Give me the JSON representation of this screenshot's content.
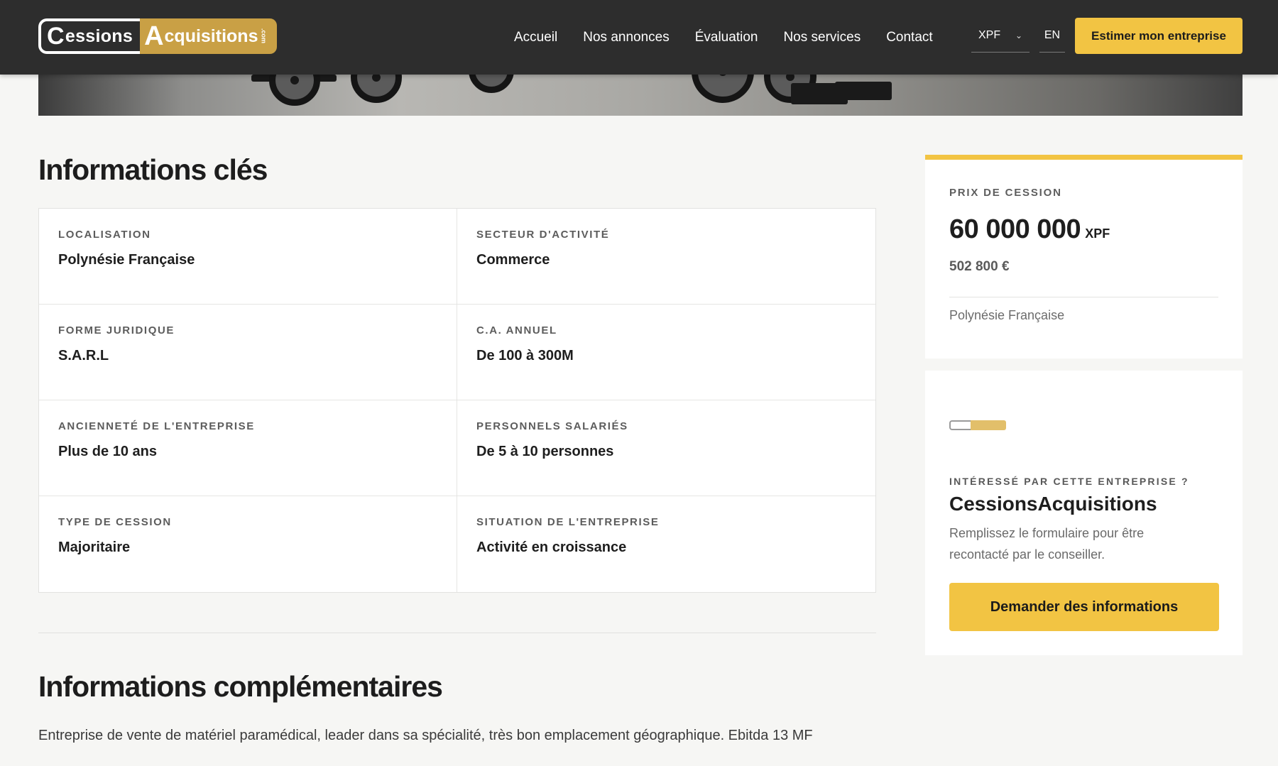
{
  "header": {
    "logo_left_cap": "C",
    "logo_left_text": "essions",
    "logo_right_cap": "A",
    "logo_right_text": "cquisitions",
    "logo_right_suffix": ".com",
    "nav": [
      "Accueil",
      "Nos annonces",
      "Évaluation",
      "Nos services",
      "Contact"
    ],
    "currency": "XPF",
    "language": "EN",
    "cta": "Estimer mon entreprise"
  },
  "key_info": {
    "title": "Informations clés",
    "items": [
      {
        "label": "LOCALISATION",
        "value": "Polynésie Française"
      },
      {
        "label": "SECTEUR D'ACTIVITÉ",
        "value": "Commerce"
      },
      {
        "label": "FORME JURIDIQUE",
        "value": "S.A.R.L"
      },
      {
        "label": "C.A. ANNUEL",
        "value": "De 100 à 300M"
      },
      {
        "label": "ANCIENNETÉ DE L'ENTREPRISE",
        "value": "Plus de 10 ans"
      },
      {
        "label": "PERSONNELS SALARIÉS",
        "value": "De 5 à 10 personnes"
      },
      {
        "label": "TYPE DE CESSION",
        "value": "Majoritaire"
      },
      {
        "label": "SITUATION DE L'ENTREPRISE",
        "value": "Activité en croissance"
      }
    ]
  },
  "extra_info": {
    "title": "Informations complémentaires",
    "description": "Entreprise de vente de matériel paramédical, leader dans sa spécialité, très bon emplacement géographique. Ebitda 13 MF"
  },
  "price_card": {
    "label": "PRIX DE CESSION",
    "amount": "60 000 000",
    "currency": "XPF",
    "euro": "502 800 €",
    "location": "Polynésie Française"
  },
  "contact_card": {
    "label": "INTÉRESSÉ PAR CETTE ENTREPRISE ?",
    "company": "CessionsAcquisitions",
    "note": "Remplissez le formulaire pour être recontacté par le conseiller.",
    "cta": "Demander des informations"
  },
  "colors": {
    "accent": "#f2c443",
    "header_bg": "#2d2d2d",
    "logo_gold": "#c9a045",
    "page_bg": "#f6f6f4"
  }
}
